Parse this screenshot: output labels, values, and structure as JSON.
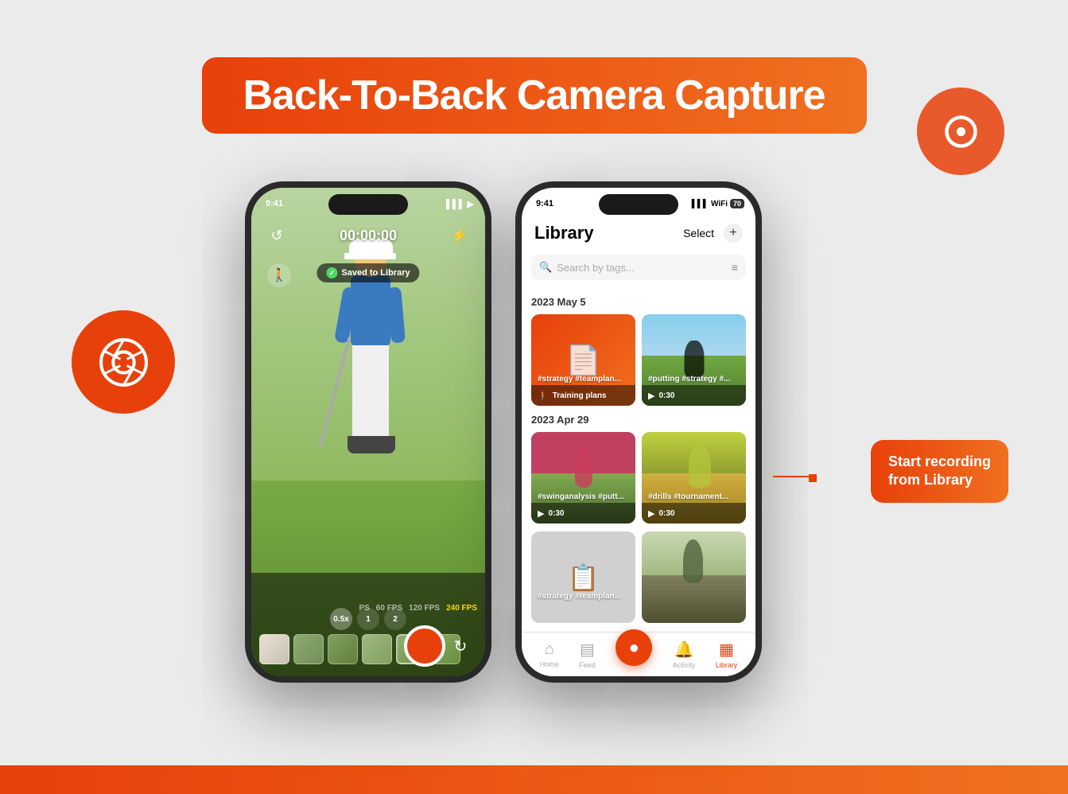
{
  "page": {
    "title": "Back-To-Back Camera Capture",
    "background_color": "#f0f0f0",
    "bottom_bar_color": "#e8500a"
  },
  "camera_circle": {
    "icon": "aperture",
    "color": "#e8400a"
  },
  "deco_circle": {
    "color": "#e8400a"
  },
  "left_phone": {
    "status_time": "9:41",
    "status_signal": "●●●",
    "timer": "00:00:00",
    "saved_badge": "Saved to Library",
    "zoom_options": [
      "0.5x",
      "1",
      "2"
    ],
    "fps_options": [
      "PS",
      "60 FPS",
      "120 FPS",
      "240 FPS"
    ],
    "shutter_color": "#e8400a"
  },
  "right_phone": {
    "status_time": "9:41",
    "library_title": "Library",
    "select_label": "Select",
    "add_label": "+",
    "search_placeholder": "Search by tags...",
    "section1_date": "2023 May 5",
    "section2_date": "2023 Apr 29",
    "card1_tags": "#strategy #teamplan...",
    "card1_footer": "Training plans",
    "card2_tags": "#putting #strategy #...",
    "card2_duration": "0:30",
    "card3_tags": "#swinganalysis #putt...",
    "card3_duration": "0:30",
    "card4_tags": "#drills #tournament...",
    "card4_duration": "0:30",
    "card5_tags": "#strategy #teamplan...",
    "nav_home": "Home",
    "nav_feed": "Feed",
    "nav_activity": "Activity",
    "nav_library": "Library"
  },
  "callout": {
    "text": "Start recording\nfrom Library",
    "line1": "Start recording",
    "line2": "from Library"
  }
}
